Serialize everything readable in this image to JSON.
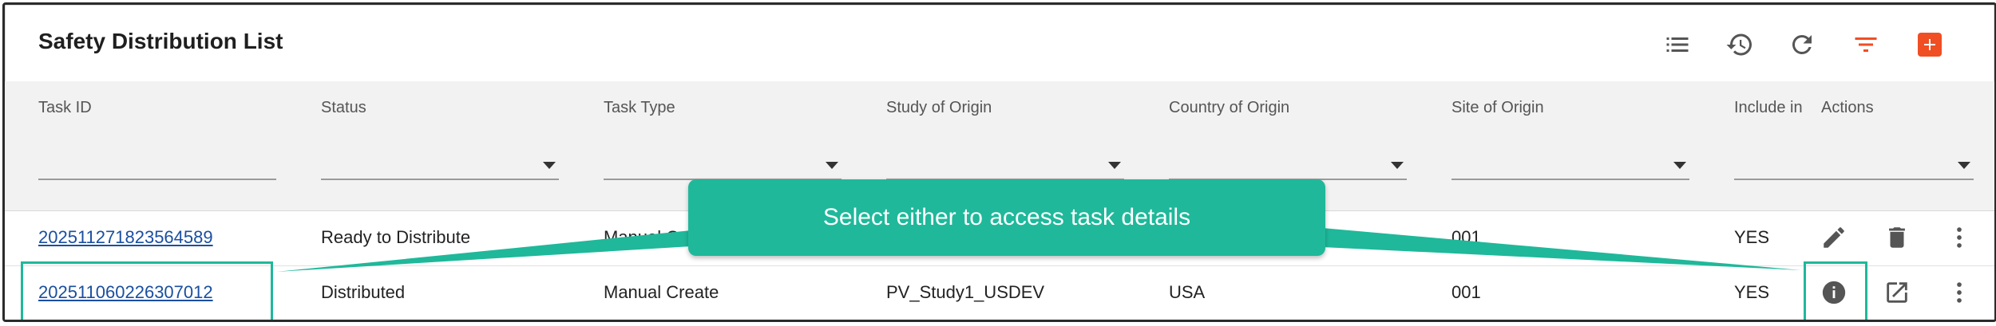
{
  "header": {
    "title": "Safety Distribution List"
  },
  "toolbar": [
    {
      "name": "list-view-icon"
    },
    {
      "name": "history-icon"
    },
    {
      "name": "refresh-icon"
    },
    {
      "name": "filter-icon"
    },
    {
      "name": "add-icon"
    }
  ],
  "columns": [
    "Task ID",
    "Status",
    "Task Type",
    "Study of Origin",
    "Country of Origin",
    "Site of Origin",
    "Include in",
    "Actions"
  ],
  "rows": [
    {
      "task_id": "202511271823564589",
      "status": "Ready to Distribute",
      "task_type": "Manual C",
      "study": "",
      "country": "",
      "site": "001",
      "include": "YES"
    },
    {
      "task_id": "202511060226307012",
      "status": "Distributed",
      "task_type": "Manual Create",
      "study": "PV_Study1_USDEV",
      "country": "USA",
      "site": "001",
      "include": "YES"
    }
  ],
  "callout": {
    "text": "Select either to access task details"
  },
  "colors": {
    "accent": "#f04e23",
    "callout": "#1fb89a",
    "link": "#1a4fa0"
  }
}
